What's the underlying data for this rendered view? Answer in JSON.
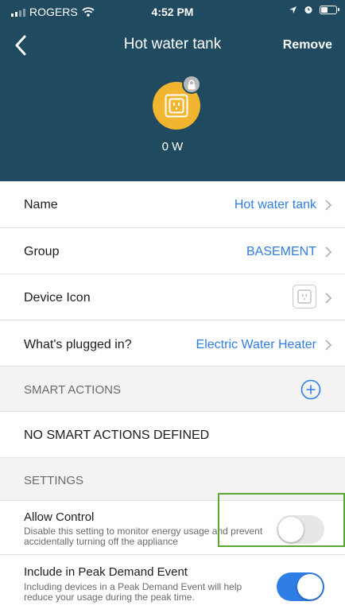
{
  "status_bar": {
    "carrier": "ROGERS",
    "time": "4:52 PM"
  },
  "nav": {
    "title": "Hot water tank",
    "remove_label": "Remove"
  },
  "device": {
    "power": "0 W",
    "accent_color": "#f2b530",
    "icon": "outlet-icon",
    "locked": true
  },
  "rows": {
    "name": {
      "label": "Name",
      "value": "Hot water tank"
    },
    "group": {
      "label": "Group",
      "value": "BASEMENT"
    },
    "device_icon": {
      "label": "Device Icon",
      "icon": "outlet-icon"
    },
    "plugged_in": {
      "label": "What's plugged in?",
      "value": "Electric Water Heater"
    }
  },
  "smart_actions": {
    "header": "SMART ACTIONS",
    "empty_text": "NO SMART ACTIONS DEFINED"
  },
  "settings": {
    "header": "SETTINGS",
    "allow_control": {
      "title": "Allow Control",
      "description": "Disable this setting to monitor energy usage and prevent accidentally turning off the appliance",
      "enabled": false
    },
    "peak_demand": {
      "title": "Include in Peak Demand Event",
      "description": "Including devices in a Peak Demand Event will help reduce your usage during the peak time.",
      "enabled": true
    }
  },
  "colors": {
    "header_bg": "#1f4a5f",
    "link_blue": "#2f7ee6",
    "highlight_green": "#5aa832"
  }
}
